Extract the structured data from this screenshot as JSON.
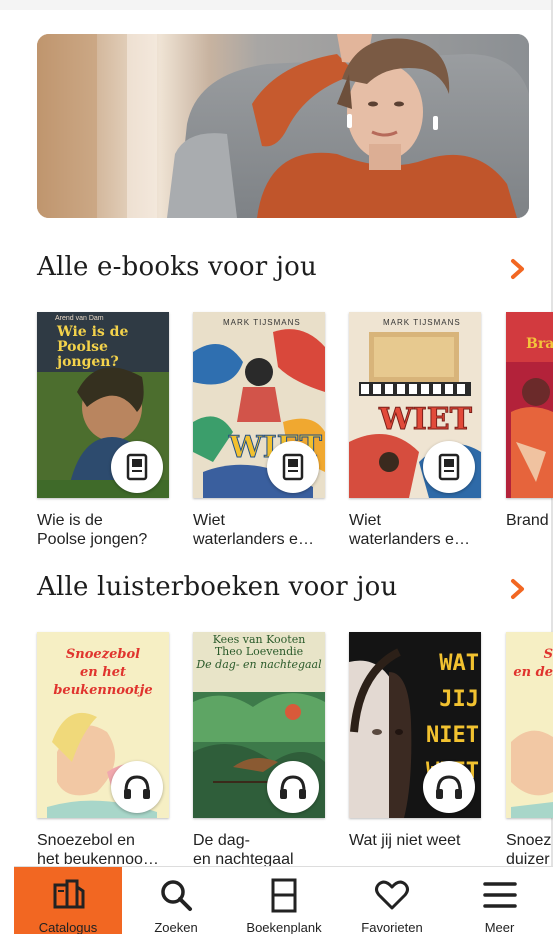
{
  "colors": {
    "accent": "#f26722",
    "text": "#1d1d1d"
  },
  "sections": [
    {
      "title": "Alle e-books voor jou",
      "badge_icon": "ebook-icon",
      "items": [
        {
          "title": "Wie is de\nPoolse jongen?",
          "cover_author": "Arend van Dam",
          "cover_title": "Wie is de\nPoolse jongen?"
        },
        {
          "title": "Wiet\nwaterlanders e…",
          "cover_author": "MARK TIJSMANS",
          "cover_title": "WIET"
        },
        {
          "title": "Wiet\nwaterlanders e…",
          "cover_author": "MARK TIJSMANS",
          "cover_title": "WIET"
        },
        {
          "title": "Brand",
          "cover_author": "",
          "cover_title": "Bra"
        }
      ]
    },
    {
      "title": "Alle luisterboeken voor jou",
      "badge_icon": "headphones-icon",
      "items": [
        {
          "title": "Snoezebol en\nhet beukennoo…",
          "cover_author": "",
          "cover_title": "Snoezebol\nen het beukennootje"
        },
        {
          "title": "De dag-\nen nachtegaal",
          "cover_author": "Kees van Kooten\nTheo Loevendie",
          "cover_title": "De dag- en nachtegaal"
        },
        {
          "title": "Wat jij niet weet",
          "cover_author": "",
          "cover_title": "WAT JIJ\nNIET\nWEET"
        },
        {
          "title": "Snoez\nduizer",
          "cover_author": "",
          "cover_title": "S\nen de"
        }
      ]
    }
  ],
  "tabs": [
    {
      "label": "Catalogus",
      "icon": "catalog-icon",
      "active": true
    },
    {
      "label": "Zoeken",
      "icon": "search-icon",
      "active": false
    },
    {
      "label": "Boekenplank",
      "icon": "bookshelf-icon",
      "active": false
    },
    {
      "label": "Favorieten",
      "icon": "heart-icon",
      "active": false
    },
    {
      "label": "Meer",
      "icon": "menu-icon",
      "active": false
    }
  ]
}
